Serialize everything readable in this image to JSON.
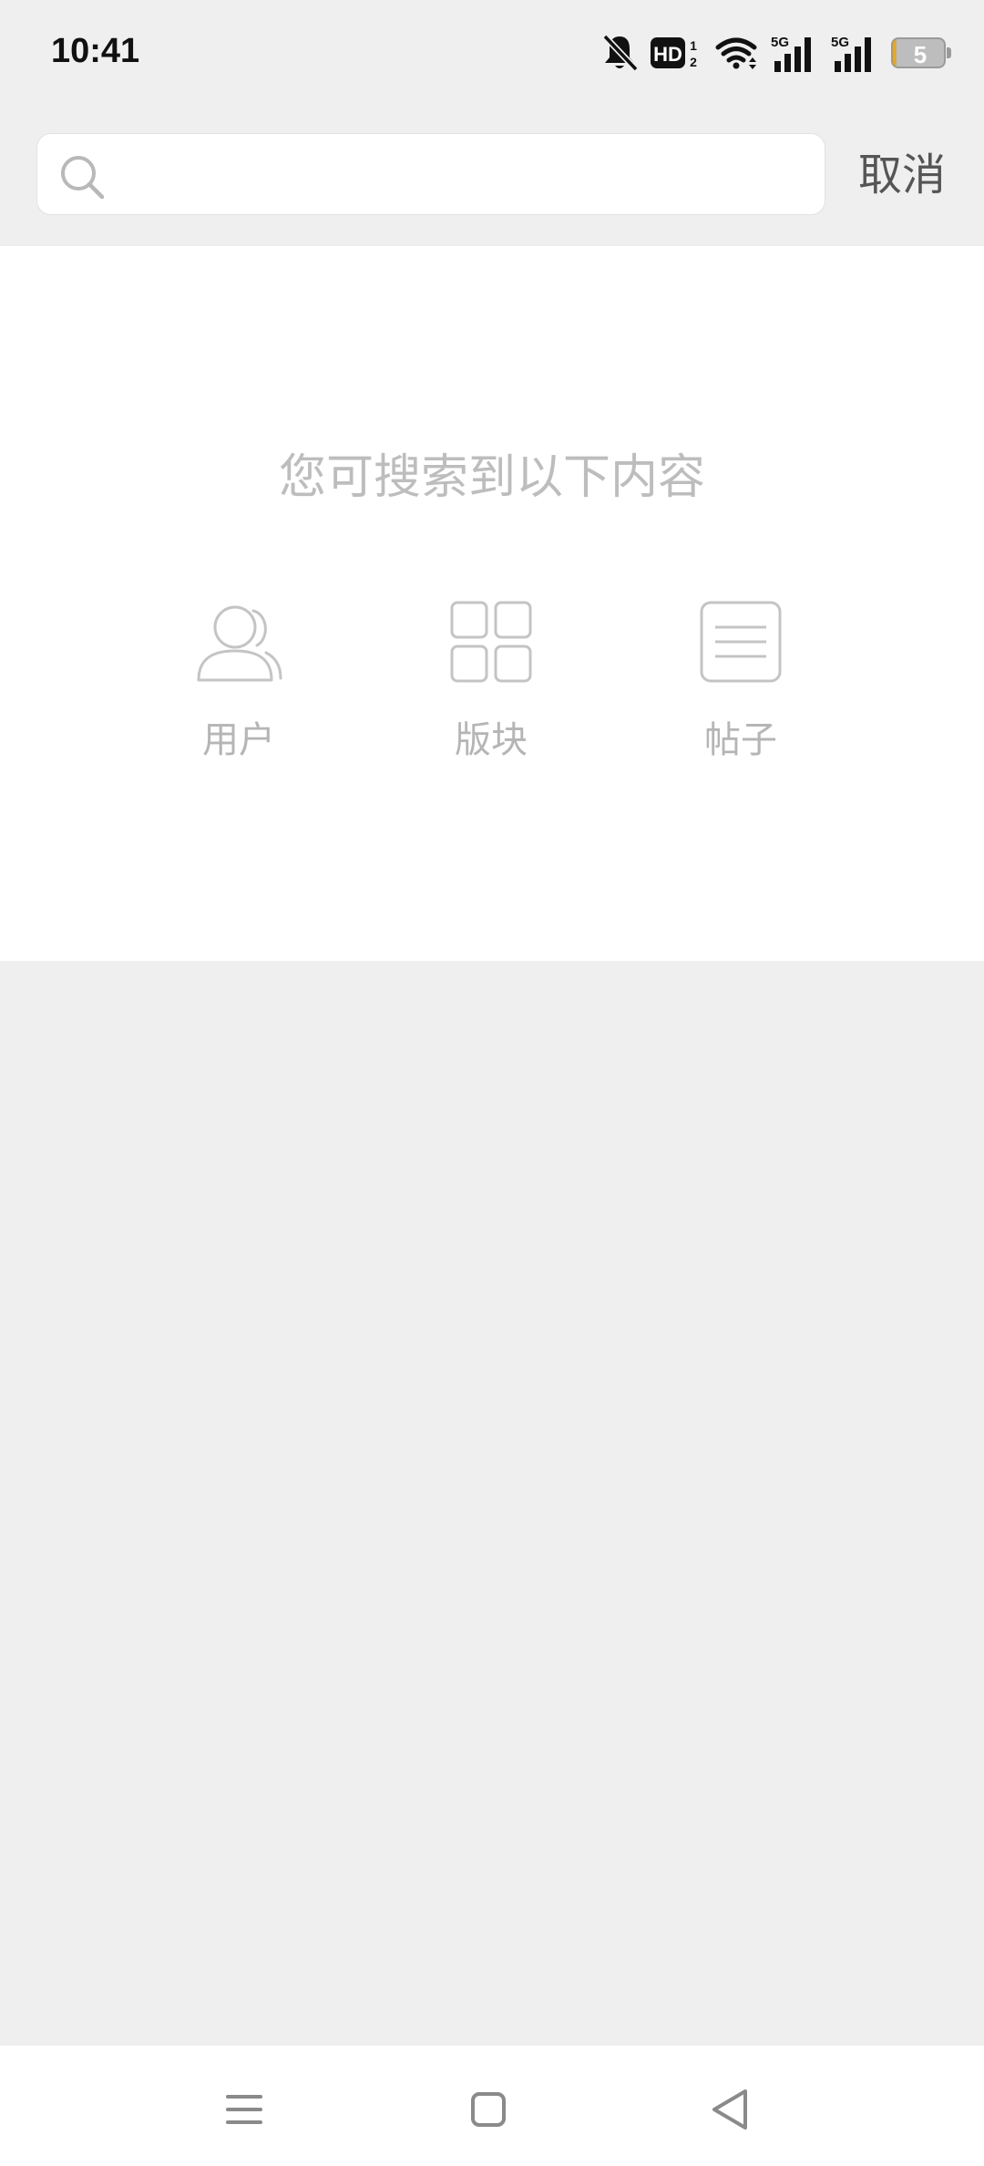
{
  "status_bar": {
    "time": "10:41",
    "hd_label": "HD",
    "hd_sub1": "1",
    "hd_sub2": "2",
    "network1": "5G",
    "network2": "5G",
    "battery_level": "5",
    "battery_fraction": 0.05,
    "battery_accent": "#e2a92a",
    "icons": [
      "bell-off-icon",
      "hd-icon",
      "wifi-icon",
      "signal-icon",
      "signal-icon",
      "battery-icon"
    ]
  },
  "search": {
    "value": "",
    "placeholder": "",
    "cancel_label": "取消"
  },
  "hint": {
    "title": "您可搜索到以下内容",
    "categories": [
      {
        "label": "用户",
        "icon": "users-icon"
      },
      {
        "label": "版块",
        "icon": "grid-icon"
      },
      {
        "label": "帖子",
        "icon": "document-icon"
      }
    ]
  },
  "nav": {
    "icons": [
      "menu-icon",
      "home-square-icon",
      "back-triangle-icon"
    ]
  },
  "colors": {
    "background": "#efefef",
    "panel": "#ffffff",
    "hint_text": "#bdbdbd",
    "icon_stroke": "#c4c4c4",
    "cancel_text": "#555555"
  }
}
